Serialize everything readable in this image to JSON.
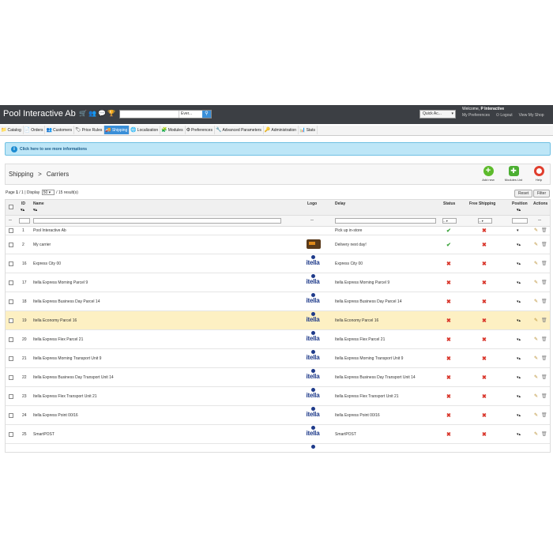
{
  "header": {
    "shop_name": "Pool Interactive Ab",
    "search_placeholder": "",
    "search_scope": "Ever...",
    "quick_access": "Quick Ac...",
    "welcome_prefix": "Welcome,",
    "welcome_user": "P Interactive",
    "links": {
      "preferences": "My Preferences",
      "logout": "Logout",
      "view_shop": "View My Shop"
    }
  },
  "menu": [
    {
      "label": "Catalog",
      "icon": "📁"
    },
    {
      "label": "Orders",
      "icon": "📄"
    },
    {
      "label": "Customers",
      "icon": "👥"
    },
    {
      "label": "Price Rules",
      "icon": "🏷"
    },
    {
      "label": "Shipping",
      "icon": "🚚",
      "active": true
    },
    {
      "label": "Localization",
      "icon": "🌐"
    },
    {
      "label": "Modules",
      "icon": "🧩"
    },
    {
      "label": "Preferences",
      "icon": "⚙"
    },
    {
      "label": "Advanced Parameters",
      "icon": "🔧"
    },
    {
      "label": "Administration",
      "icon": "🔑"
    },
    {
      "label": "Stats",
      "icon": "📊"
    }
  ],
  "info_bar": {
    "text": "Click here to see more informations",
    "icon": "info-icon"
  },
  "toolbar": {
    "breadcrumb_section": "Shipping",
    "breadcrumb_sep": ">",
    "breadcrumb_page": "Carriers",
    "add_new": "Add new",
    "modules_list": "Modules List",
    "help": "Help"
  },
  "pagination": {
    "page_label": "Page",
    "page": "1",
    "of": "/ 1",
    "display_label": "| Display",
    "per_page": "50",
    "results": "/ 15 result(s)",
    "reset": "Reset",
    "filter": "Filter"
  },
  "columns": {
    "id": "ID",
    "name": "Name",
    "logo": "Logo",
    "delay": "Delay",
    "status": "Status",
    "free_shipping": "Free Shipping",
    "position": "Position",
    "actions": "Actions",
    "sort_arrows": "▾▴"
  },
  "filters": {
    "dash": "--",
    "select": "--"
  },
  "rows": [
    {
      "id": "1",
      "name": "Pool Interactive Ab",
      "logo": "",
      "delay": "Pick up in-store",
      "status": "ok",
      "free": "no",
      "position": "▾"
    },
    {
      "id": "2",
      "name": "My carrier",
      "logo": "truck",
      "delay": "Delivery next day!",
      "status": "ok",
      "free": "no",
      "position": "▾▴"
    },
    {
      "id": "16",
      "name": "Express City 00",
      "logo": "itella",
      "delay": "Express City 00",
      "status": "no",
      "free": "no",
      "position": "▾▴"
    },
    {
      "id": "17",
      "name": "Itella Express Morning Parcel 9",
      "logo": "itella",
      "delay": "Itella Express Morning Parcel 9",
      "status": "no",
      "free": "no",
      "position": "▾▴"
    },
    {
      "id": "18",
      "name": "Itella Express Business Day Parcel 14",
      "logo": "itella",
      "delay": "Itella Express Business Day Parcel 14",
      "status": "no",
      "free": "no",
      "position": "▾▴"
    },
    {
      "id": "19",
      "name": "Itella Economy Parcel 16",
      "logo": "itella",
      "delay": "Itella Economy Parcel 16",
      "status": "no",
      "free": "no",
      "position": "▾▴",
      "highlight": true
    },
    {
      "id": "20",
      "name": "Itella Express Flex Parcel 21",
      "logo": "itella",
      "delay": "Itella Express Flex Parcel 21",
      "status": "no",
      "free": "no",
      "position": "▾▴"
    },
    {
      "id": "21",
      "name": "Itella Express Morning Transport Unit 9",
      "logo": "itella",
      "delay": "Itella Express Morning Transport Unit 9",
      "status": "no",
      "free": "no",
      "position": "▾▴"
    },
    {
      "id": "22",
      "name": "Itella Express Business Day Transport Unit 14",
      "logo": "itella",
      "delay": "Itella Express Business Day Transport Unit 14",
      "status": "no",
      "free": "no",
      "position": "▾▴"
    },
    {
      "id": "23",
      "name": "Itella Express Flex Transport Unit 21",
      "logo": "itella",
      "delay": "Itella Express Flex Transport Unit 21",
      "status": "no",
      "free": "no",
      "position": "▾▴"
    },
    {
      "id": "24",
      "name": "Itella Express Point 00/16",
      "logo": "itella",
      "delay": "Itella Express Point 00/16",
      "status": "no",
      "free": "no",
      "position": "▾▴"
    },
    {
      "id": "25",
      "name": "SmartPOST",
      "logo": "itella",
      "delay": "SmartPOST",
      "status": "no",
      "free": "no",
      "position": "▾▴"
    }
  ],
  "logo_text": "itella",
  "glyphs": {
    "ok": "✔",
    "no": "✖",
    "edit": "✎",
    "delete": "🗑"
  },
  "colors": {
    "topbar": "#3c3f44",
    "accent": "#3a8fd8",
    "highlight": "#fdf0c3",
    "ok": "#3aa33a",
    "no": "#d9362b"
  }
}
